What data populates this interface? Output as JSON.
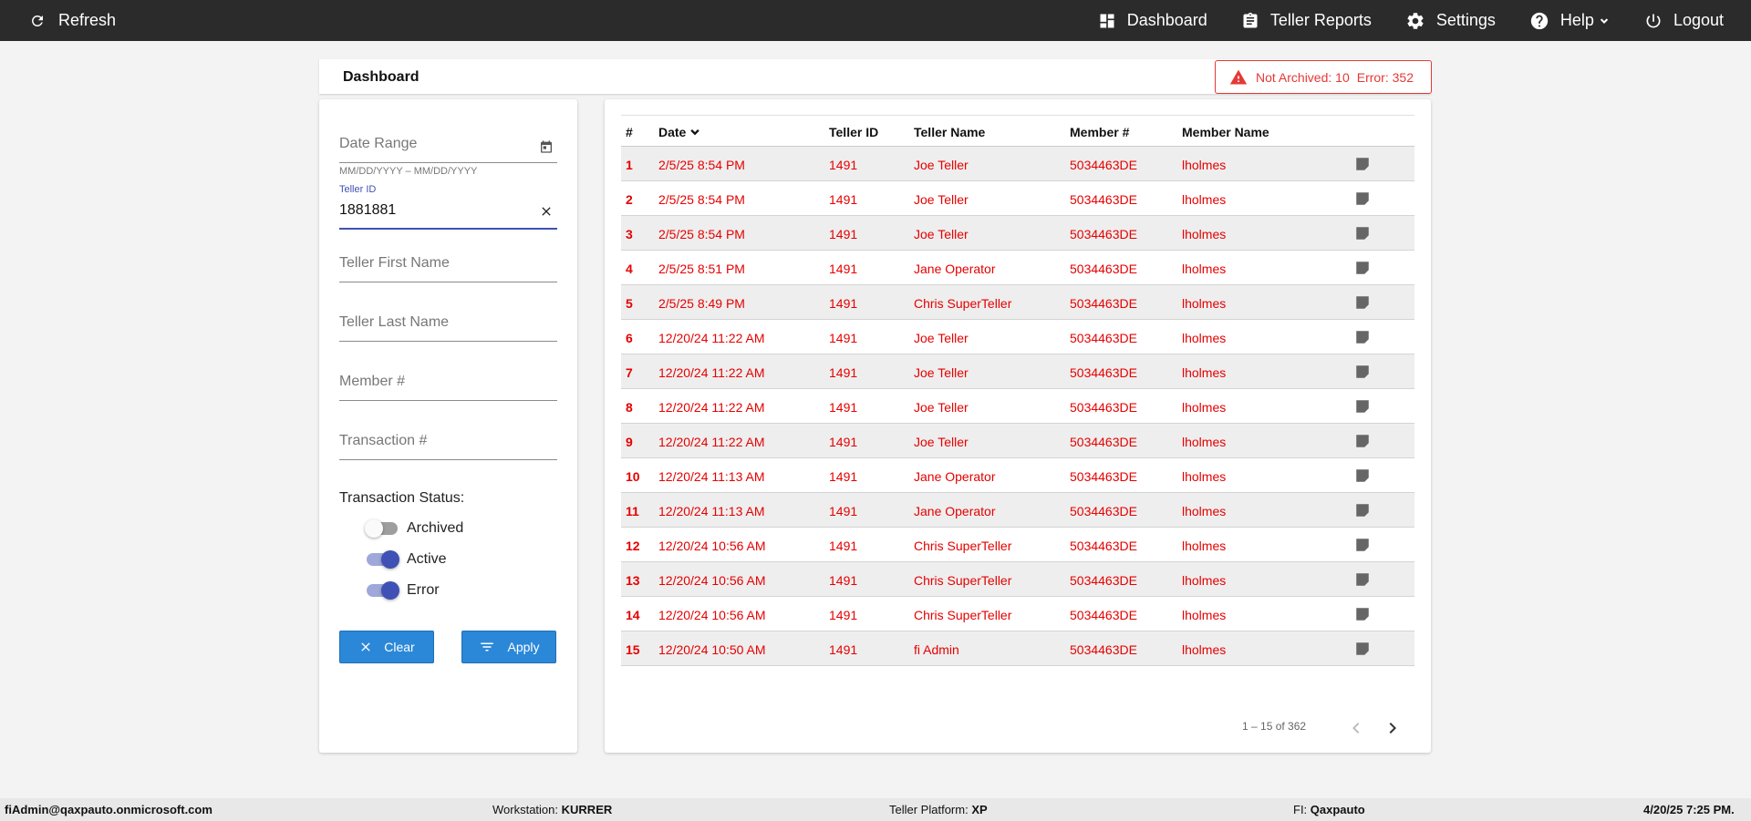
{
  "topbar": {
    "refresh_label": "Refresh",
    "dashboard_label": "Dashboard",
    "teller_reports_label": "Teller Reports",
    "settings_label": "Settings",
    "help_label": "Help",
    "logout_label": "Logout"
  },
  "header": {
    "title": "Dashboard",
    "alert_not_archived": "Not Archived: 10",
    "alert_error": "Error: 352"
  },
  "filters": {
    "date_range_placeholder": "Date Range",
    "date_hint": "MM/DD/YYYY – MM/DD/YYYY",
    "teller_id_label": "Teller ID",
    "teller_id_value": "1881881",
    "teller_first_name_placeholder": "Teller First Name",
    "teller_last_name_placeholder": "Teller Last Name",
    "member_placeholder": "Member #",
    "transaction_placeholder": "Transaction #",
    "status_label": "Transaction Status:",
    "archived_label": "Archived",
    "archived_on": false,
    "active_label": "Active",
    "active_on": true,
    "error_label": "Error",
    "error_on": true,
    "clear_label": "Clear",
    "apply_label": "Apply"
  },
  "table": {
    "headers": {
      "num": "#",
      "date": "Date",
      "teller_id": "Teller ID",
      "teller_name": "Teller Name",
      "member_num": "Member #",
      "member_name": "Member Name"
    },
    "rows": [
      {
        "num": "1",
        "date": "2/5/25 8:54 PM",
        "teller_id": "1491",
        "teller_name": "Joe Teller",
        "member_num": "5034463DE",
        "member_name": "lholmes"
      },
      {
        "num": "2",
        "date": "2/5/25 8:54 PM",
        "teller_id": "1491",
        "teller_name": "Joe Teller",
        "member_num": "5034463DE",
        "member_name": "lholmes"
      },
      {
        "num": "3",
        "date": "2/5/25 8:54 PM",
        "teller_id": "1491",
        "teller_name": "Joe Teller",
        "member_num": "5034463DE",
        "member_name": "lholmes"
      },
      {
        "num": "4",
        "date": "2/5/25 8:51 PM",
        "teller_id": "1491",
        "teller_name": "Jane Operator",
        "member_num": "5034463DE",
        "member_name": "lholmes"
      },
      {
        "num": "5",
        "date": "2/5/25 8:49 PM",
        "teller_id": "1491",
        "teller_name": "Chris SuperTeller",
        "member_num": "5034463DE",
        "member_name": "lholmes"
      },
      {
        "num": "6",
        "date": "12/20/24 11:22 AM",
        "teller_id": "1491",
        "teller_name": "Joe Teller",
        "member_num": "5034463DE",
        "member_name": "lholmes"
      },
      {
        "num": "7",
        "date": "12/20/24 11:22 AM",
        "teller_id": "1491",
        "teller_name": "Joe Teller",
        "member_num": "5034463DE",
        "member_name": "lholmes"
      },
      {
        "num": "8",
        "date": "12/20/24 11:22 AM",
        "teller_id": "1491",
        "teller_name": "Joe Teller",
        "member_num": "5034463DE",
        "member_name": "lholmes"
      },
      {
        "num": "9",
        "date": "12/20/24 11:22 AM",
        "teller_id": "1491",
        "teller_name": "Joe Teller",
        "member_num": "5034463DE",
        "member_name": "lholmes"
      },
      {
        "num": "10",
        "date": "12/20/24 11:13 AM",
        "teller_id": "1491",
        "teller_name": "Jane Operator",
        "member_num": "5034463DE",
        "member_name": "lholmes"
      },
      {
        "num": "11",
        "date": "12/20/24 11:13 AM",
        "teller_id": "1491",
        "teller_name": "Jane Operator",
        "member_num": "5034463DE",
        "member_name": "lholmes"
      },
      {
        "num": "12",
        "date": "12/20/24 10:56 AM",
        "teller_id": "1491",
        "teller_name": "Chris SuperTeller",
        "member_num": "5034463DE",
        "member_name": "lholmes"
      },
      {
        "num": "13",
        "date": "12/20/24 10:56 AM",
        "teller_id": "1491",
        "teller_name": "Chris SuperTeller",
        "member_num": "5034463DE",
        "member_name": "lholmes"
      },
      {
        "num": "14",
        "date": "12/20/24 10:56 AM",
        "teller_id": "1491",
        "teller_name": "Chris SuperTeller",
        "member_num": "5034463DE",
        "member_name": "lholmes"
      },
      {
        "num": "15",
        "date": "12/20/24 10:50 AM",
        "teller_id": "1491",
        "teller_name": "fi Admin",
        "member_num": "5034463DE",
        "member_name": "lholmes"
      }
    ],
    "row_icon": "note-icon",
    "pagination": "1 – 15 of 362"
  },
  "footer": {
    "user": "fiAdmin@qaxpauto.onmicrosoft.com",
    "workstation_label": "Workstation:",
    "workstation_value": "KURRER",
    "teller_platform_label": "Teller Platform:",
    "teller_platform_value": "XP",
    "fi_label": "FI:",
    "fi_value": "Qaxpauto",
    "datetime": "4/20/25 7:25 PM."
  },
  "colors": {
    "topbar_bg": "#2b2b2b",
    "error_text": "#e60000",
    "alert": "#e53935",
    "button": "#2b88d8",
    "toggle_on": "#3f51b5"
  }
}
